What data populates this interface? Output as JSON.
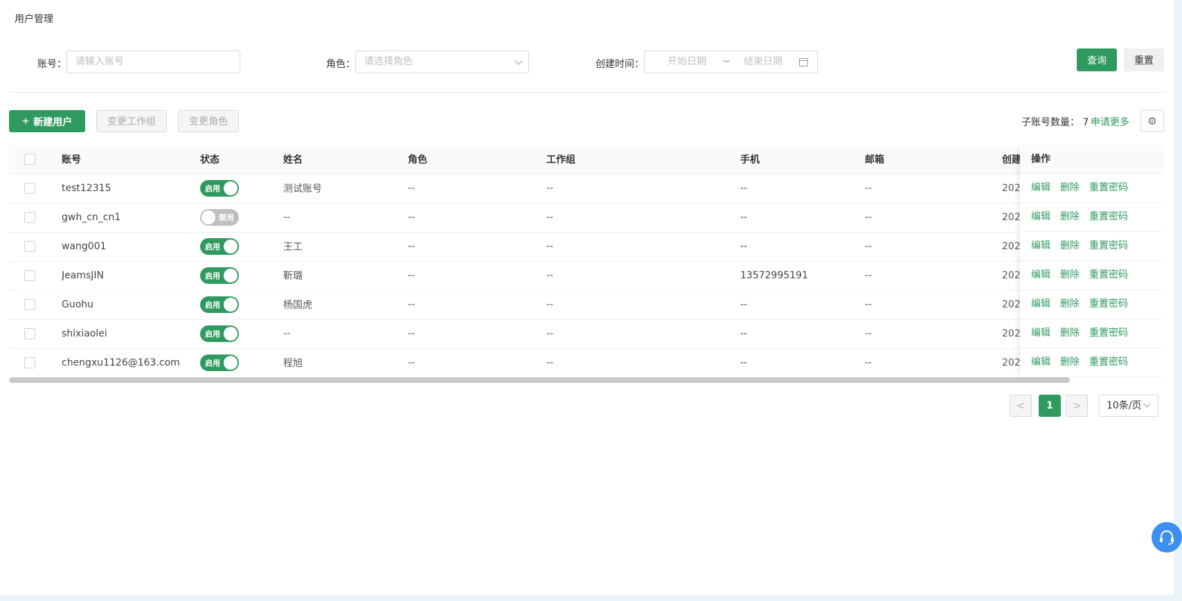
{
  "page": {
    "title": "用户管理"
  },
  "filters": {
    "account_label": "账号：",
    "account_placeholder": "请输入账号",
    "role_label": "角色：",
    "role_placeholder": "请选择角色",
    "created_label": "创建时间：",
    "start_placeholder": "开始日期",
    "date_sep": "~",
    "end_placeholder": "结束日期",
    "query_label": "查询",
    "reset_label": "重置"
  },
  "toolbar": {
    "new_user_label": "新建用户",
    "new_user_icon": "+",
    "change_group_label": "变更工作组",
    "change_role_label": "变更角色",
    "count_label": "子账号数量： 7",
    "apply_more_label": "申请更多"
  },
  "table": {
    "columns": [
      "账号",
      "状态",
      "姓名",
      "角色",
      "工作组",
      "手机",
      "邮箱",
      "创建"
    ],
    "op_column": "操作",
    "rows": [
      {
        "account": "test12315",
        "status": "启用",
        "enabled": true,
        "name": "测试账号",
        "role": "--",
        "group": "--",
        "phone": "--",
        "email": "--",
        "created": "202"
      },
      {
        "account": "gwh_cn_cn1",
        "status": "禁用",
        "enabled": false,
        "name": "--",
        "role": "--",
        "group": "--",
        "phone": "--",
        "email": "--",
        "created": "202"
      },
      {
        "account": "wang001",
        "status": "启用",
        "enabled": true,
        "name": "王工",
        "role": "--",
        "group": "--",
        "phone": "--",
        "email": "--",
        "created": "202"
      },
      {
        "account": "JeamsJIN",
        "status": "启用",
        "enabled": true,
        "name": "靳璐",
        "role": "--",
        "group": "--",
        "phone": "13572995191",
        "email": "--",
        "created": "202"
      },
      {
        "account": "Guohu",
        "status": "启用",
        "enabled": true,
        "name": "杨国虎",
        "role": "--",
        "group": "--",
        "phone": "--",
        "email": "--",
        "created": "202"
      },
      {
        "account": "shixiaolei",
        "status": "启用",
        "enabled": true,
        "name": "--",
        "role": "--",
        "group": "--",
        "phone": "--",
        "email": "--",
        "created": "202"
      },
      {
        "account": "chengxu1126@163.com",
        "status": "启用",
        "enabled": true,
        "name": "程旭",
        "role": "--",
        "group": "--",
        "phone": "--",
        "email": "--",
        "created": "202"
      }
    ],
    "actions": {
      "edit": "编辑",
      "delete": "删除",
      "reset_password": "重置密码"
    }
  },
  "pagination": {
    "prev": "<",
    "current": "1",
    "next": ">",
    "page_size": "10条/页"
  },
  "colors": {
    "primary": "#2f9a5f",
    "support": "#3d8ff0"
  },
  "icons": [
    "chevron-down-icon",
    "calendar-icon",
    "plus-icon",
    "gear-icon",
    "headset-icon"
  ]
}
